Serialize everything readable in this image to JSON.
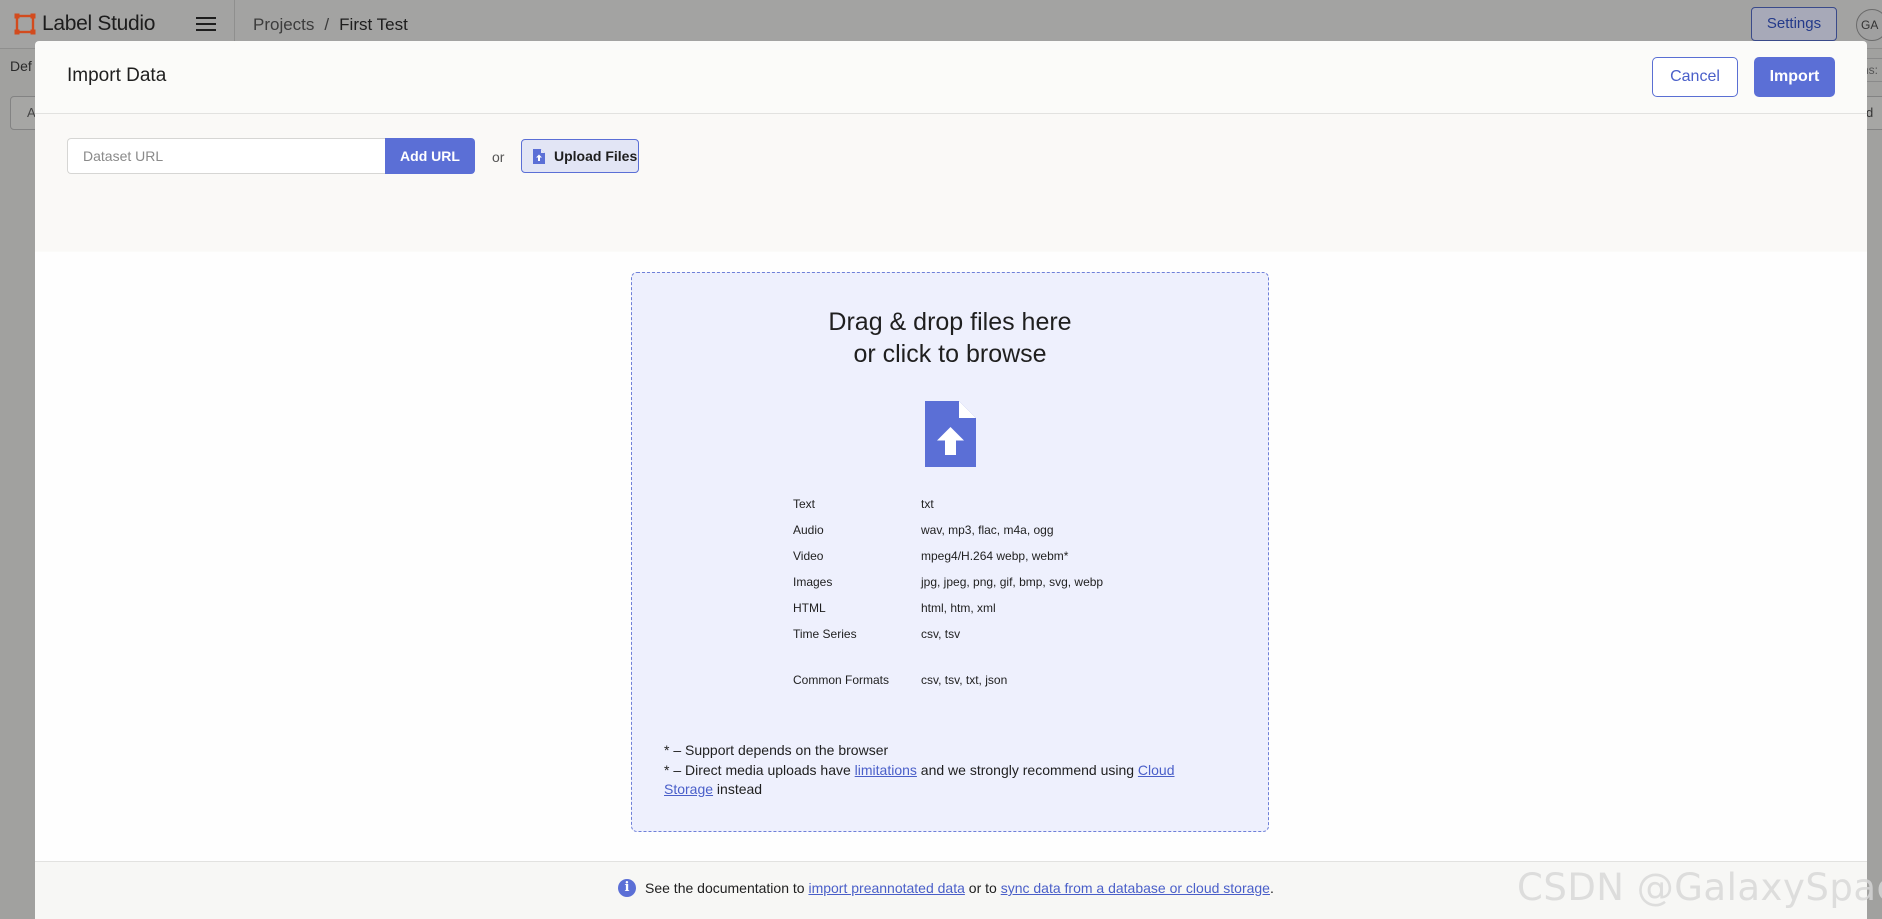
{
  "app": {
    "logo_text": "Label Studio",
    "breadcrumb": [
      "Projects",
      "First Test"
    ],
    "breadcrumb_separator": "/",
    "settings_label": "Settings",
    "avatar_initials": "GA",
    "bg_default_text": "Def",
    "bg_button_letter": "A",
    "bg_right_text_1": "ns:",
    "bg_right_text_2": "d"
  },
  "modal": {
    "title": "Import Data",
    "cancel_label": "Cancel",
    "import_label": "Import",
    "url_placeholder": "Dataset URL",
    "add_url_label": "Add URL",
    "or_text": "or",
    "upload_label": "Upload Files",
    "dropzone": {
      "title_line1": "Drag & drop files here",
      "title_line2": "or click to browse",
      "formats": [
        {
          "type": "Text",
          "ext": "txt"
        },
        {
          "type": "Audio",
          "ext": "wav, mp3, flac, m4a, ogg"
        },
        {
          "type": "Video",
          "ext": "mpeg4/H.264 webp, webm*"
        },
        {
          "type": "Images",
          "ext": "jpg, jpeg, png, gif, bmp, svg, webp"
        },
        {
          "type": "HTML",
          "ext": "html, htm, xml"
        },
        {
          "type": "Time Series",
          "ext": "csv, tsv"
        }
      ],
      "common_formats": {
        "type": "Common Formats",
        "ext": "csv, tsv, txt, json"
      },
      "note1": "* – Support depends on the browser",
      "note2_prefix": "* – Direct media uploads have ",
      "note2_link1": "limitations",
      "note2_middle": " and we strongly recommend using ",
      "note2_link2": "Cloud Storage",
      "note2_suffix": " instead"
    },
    "footer": {
      "info_glyph": "i",
      "text_prefix": "See the documentation to ",
      "link1": "import preannotated data",
      "text_middle": " or to ",
      "link2": "sync data from a database or cloud storage",
      "text_suffix": "."
    }
  },
  "watermark": "CSDN @GalaxySpaceX",
  "colors": {
    "accent": "#5b6fd6",
    "link": "#4a5fc9",
    "dropzone_bg": "#eef0fd",
    "overlay_bg": "#a1a19f",
    "logo": "#e8511f"
  },
  "icons": [
    "label-studio-logo-icon",
    "hamburger-menu-icon",
    "file-upload-icon",
    "info-icon"
  ]
}
